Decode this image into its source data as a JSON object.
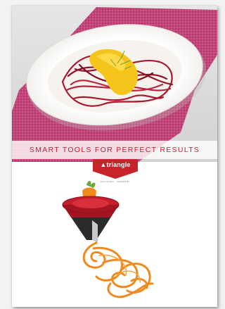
{
  "tagline": "SMART TOOLS FOR PERFECT RESULTS",
  "brand": {
    "name": "triangle",
    "location": "SOLINGEN · GERMANY",
    "color": "#c8232b"
  },
  "colors": {
    "accent": "#c0232f",
    "napkin": "#c2457a",
    "beet": "#a8182f",
    "sauce": "#f5c51c",
    "carrot": "#f08a1e"
  },
  "icons": [
    "triangle-logo-icon"
  ]
}
